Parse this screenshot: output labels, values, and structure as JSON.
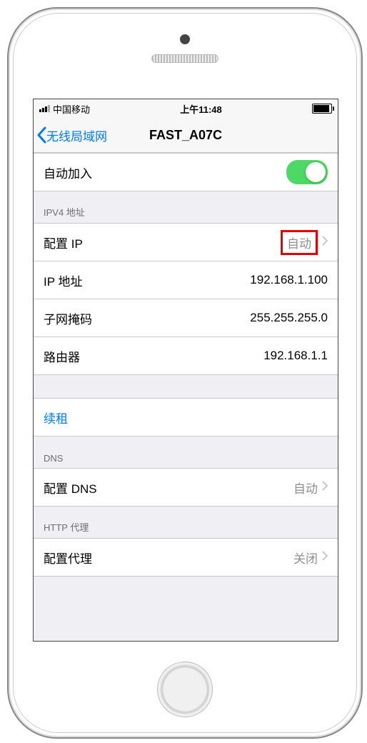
{
  "status": {
    "carrier": "中国移动",
    "time": "上午11:48"
  },
  "nav": {
    "back": "无线局域网",
    "title": "FAST_A07C"
  },
  "autojoin": {
    "label": "自动加入"
  },
  "ipv4": {
    "header": "IPV4 地址",
    "configIP": {
      "label": "配置 IP",
      "value": "自动"
    },
    "ip": {
      "label": "IP 地址",
      "value": "192.168.1.100"
    },
    "subnet": {
      "label": "子网掩码",
      "value": "255.255.255.0"
    },
    "router": {
      "label": "路由器",
      "value": "192.168.1.1"
    }
  },
  "renew": {
    "label": "续租"
  },
  "dns": {
    "header": "DNS",
    "config": {
      "label": "配置 DNS",
      "value": "自动"
    }
  },
  "proxy": {
    "header": "HTTP 代理",
    "config": {
      "label": "配置代理",
      "value": "关闭"
    }
  }
}
